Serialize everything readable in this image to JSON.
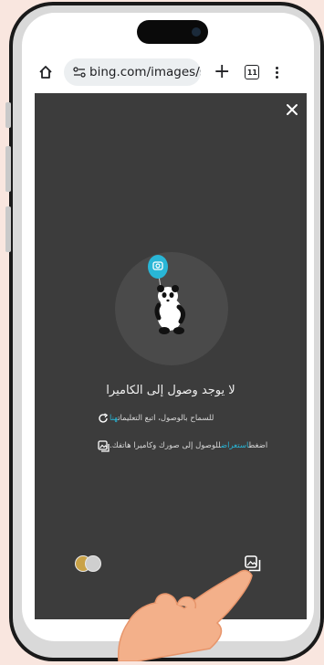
{
  "browser": {
    "url": "bing.com/images/sear",
    "tab_count": "11"
  },
  "camera_view": {
    "title": "لا يوجد وصول إلى الكاميرا",
    "instruction_1_prefix": "للسماح بالوصول، اتبع التعليمات",
    "instruction_1_link": "هنا",
    "instruction_2_prefix": "اضغط",
    "instruction_2_link": "استعراض",
    "instruction_2_suffix": "للوصول إلى صورك وكاميرا هاتفك."
  },
  "colors": {
    "viewer_bg": "#3c3c3c",
    "link": "#29b6d6",
    "balloon": "#29b6d6"
  },
  "icons": [
    "home-icon",
    "site-settings-icon",
    "plus-icon",
    "tabs-icon",
    "more-icon",
    "close-icon",
    "refresh-icon",
    "gallery-icon"
  ]
}
